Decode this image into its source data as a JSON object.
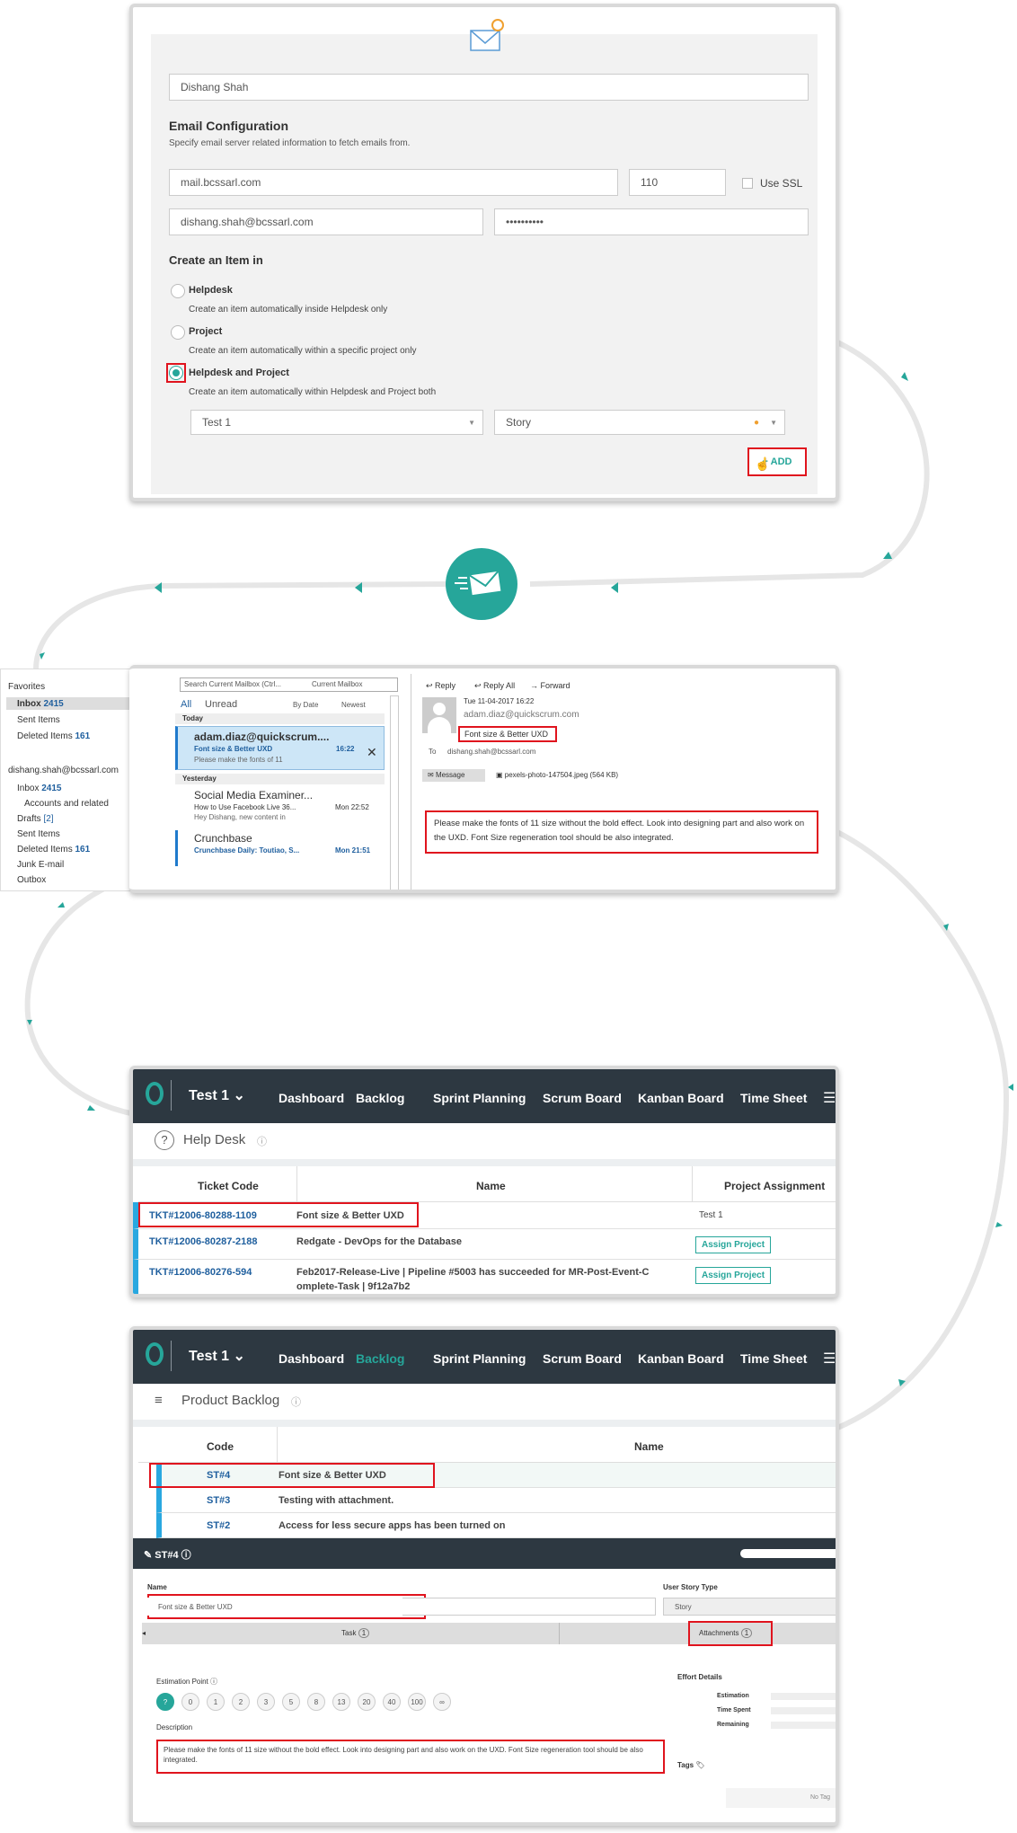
{
  "config": {
    "name_value": "Dishang Shah",
    "section_title": "Email Configuration",
    "section_desc": "Specify email server related information to fetch emails from.",
    "server": "mail.bcssarl.com",
    "port": "110",
    "ssl_label": "Use SSL",
    "email": "dishang.shah@bcssarl.com",
    "password": "••••••••••",
    "create_title": "Create an Item in",
    "options": [
      {
        "label": "Helpdesk",
        "desc": "Create an item automatically inside Helpdesk only"
      },
      {
        "label": "Project",
        "desc": "Create an item automatically within a specific project only"
      },
      {
        "label": "Helpdesk and Project",
        "desc": "Create an item automatically within Helpdesk and Project both"
      }
    ],
    "project_select": "Test 1",
    "type_select": "Story",
    "add_label": "+ ADD"
  },
  "outlook": {
    "folders": {
      "favorites": "Favorites",
      "inbox": "Inbox",
      "inbox_count": "2415",
      "sent": "Sent Items",
      "deleted": "Deleted Items",
      "deleted_count": "161",
      "account": "dishang.shah@bcssarl.com",
      "inbox2": "Inbox",
      "inbox2_count": "2415",
      "accounts_related": "Accounts and related",
      "drafts": "Drafts",
      "drafts_count": "[2]",
      "sent2": "Sent Items",
      "deleted2": "Deleted Items",
      "deleted2_count": "161",
      "junk": "Junk E-mail",
      "outbox": "Outbox"
    },
    "search_placeholder": "Search Current Mailbox (Ctrl...",
    "search_scope": "Current Mailbox",
    "filter_all": "All",
    "filter_unread": "Unread",
    "sort_by": "By Date",
    "sort_order": "Newest",
    "group_today": "Today",
    "group_yesterday": "Yesterday",
    "mails": [
      {
        "from": "adam.diaz@quickscrum....",
        "subject": "Font size & Better UXD",
        "time": "16:22",
        "preview": "Please make the fonts of 11"
      },
      {
        "from": "Social Media Examiner...",
        "subject": "How to Use Facebook Live 36...",
        "time": "Mon 22:52",
        "preview": "Hey Dishang, new content in"
      },
      {
        "from": "Crunchbase",
        "subject": "Crunchbase Daily: Toutiao, S...",
        "time": "Mon 21:51",
        "preview": ""
      }
    ],
    "reading": {
      "reply": "Reply",
      "reply_all": "Reply All",
      "forward": "Forward",
      "date": "Tue 11-04-2017 16:22",
      "sender": "adam.diaz@quickscrum.com",
      "subject": "Font size & Better UXD",
      "to_label": "To",
      "to": "dishang.shah@bcssarl.com",
      "message_tab": "Message",
      "attachment": "pexels-photo-147504.jpeg (564 KB)",
      "body": "Please make the fonts of 11 size without the bold effect. Look into designing part and also work on the UXD. Font Size regeneration tool should be also integrated."
    }
  },
  "helpdesk": {
    "project": "Test 1",
    "nav": [
      "Dashboard",
      "Backlog",
      "Sprint Planning",
      "Scrum Board",
      "Kanban Board",
      "Time Sheet"
    ],
    "title": "Help Desk",
    "columns": [
      "Ticket Code",
      "Name",
      "Project Assignment"
    ],
    "rows": [
      {
        "code": "TKT#12006-80288-1109",
        "name": "Font size & Better UXD",
        "assign": "Test 1"
      },
      {
        "code": "TKT#12006-80287-2188",
        "name": "Redgate - DevOps for the Database",
        "assign": "Assign Project"
      },
      {
        "code": "TKT#12006-80276-594",
        "name": "Feb2017-Release-Live | Pipeline #5003 has succeeded for MR-Post-Event-C",
        "name2": "omplete-Task | 9f12a7b2",
        "assign": "Assign Project"
      }
    ]
  },
  "backlog": {
    "project": "Test 1",
    "nav": [
      "Dashboard",
      "Backlog",
      "Sprint Planning",
      "Scrum Board",
      "Kanban Board",
      "Time Sheet"
    ],
    "title": "Product Backlog",
    "columns": [
      "Code",
      "Name"
    ],
    "rows": [
      {
        "code": "ST#4",
        "name": "Font size & Better UXD"
      },
      {
        "code": "ST#3",
        "name": "Testing with attachment."
      },
      {
        "code": "ST#2",
        "name": "Access for less secure apps has been turned on"
      }
    ],
    "detail": {
      "code": "ST#4",
      "name_label": "Name",
      "name_value": "Font size & Better UXD",
      "type_label": "User Story Type",
      "type_value": "Story",
      "tab_task": "Task",
      "tab_task_count": "1",
      "tab_attach": "Attachments",
      "tab_attach_count": "1",
      "estimation_label": "Estimation Point",
      "points": [
        "?",
        "0",
        "1",
        "2",
        "3",
        "5",
        "8",
        "13",
        "20",
        "40",
        "100",
        "∞"
      ],
      "description_label": "Description",
      "description": "Please make the fonts of 11 size without the bold effect. Look into designing part and also work on the UXD. Font Size regeneration tool should be also integrated.",
      "effort_title": "Effort Details",
      "estimation": "Estimation",
      "time_spent": "Time Spent",
      "remaining": "Remaining",
      "tags": "Tags",
      "no_tags": "No Tag"
    }
  },
  "colors": {
    "teal": "#26a69a",
    "nav": "#2d3841",
    "red": "#e0141e",
    "link": "#1f5f9e"
  }
}
